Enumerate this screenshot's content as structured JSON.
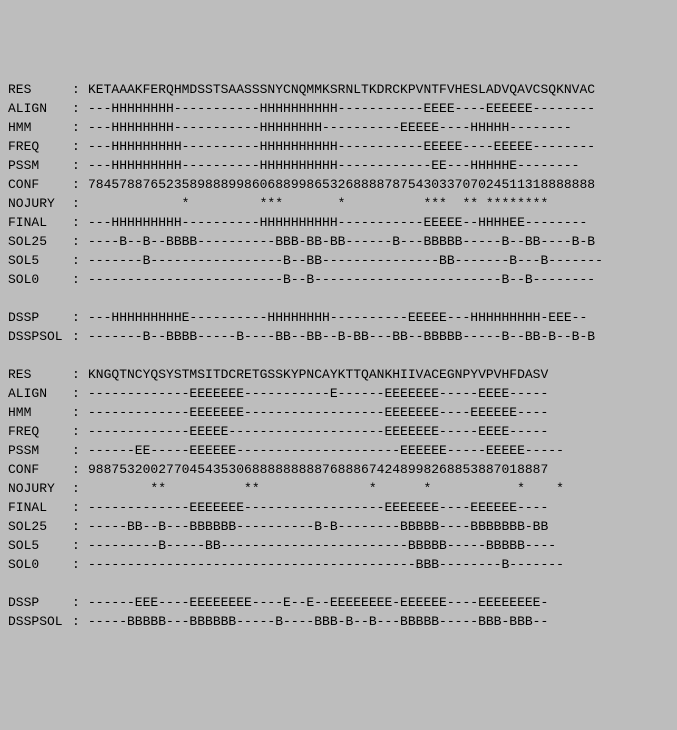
{
  "blocks": [
    {
      "rows": [
        {
          "label": "RES",
          "seq": "KETAAAKFERQHMDSSTSAASSSNYCNQMMKSRNLTKDRCKPVNTFVHESLADVQAVCSQKNVAC"
        },
        {
          "label": "ALIGN",
          "seq": "---HHHHHHHH-----------HHHHHHHHHH-----------EEEE----EEEEEE--------"
        },
        {
          "label": "HMM",
          "seq": "---HHHHHHHH-----------HHHHHHHH----------EEEEE----HHHHH--------"
        },
        {
          "label": "FREQ",
          "seq": "---HHHHHHHHH----------HHHHHHHHHH-----------EEEEE----EEEEE--------"
        },
        {
          "label": "PSSM",
          "seq": "---HHHHHHHHH----------HHHHHHHHHH------------EE---HHHHHE--------"
        },
        {
          "label": "CONF",
          "seq": "78457887652358988899860688998653268888787543033707024511318888888"
        },
        {
          "label": "NOJURY",
          "seq": "            *         ***       *          ***  ** ********"
        },
        {
          "label": "FINAL",
          "seq": "---HHHHHHHHH----------HHHHHHHHHH-----------EEEEE--HHHHEE--------"
        },
        {
          "label": "SOL25",
          "seq": "----B--B--BBBB----------BBB-BB-BB------B---BBBBB-----B--BB----B-B"
        },
        {
          "label": "SOL5",
          "seq": "-------B-----------------B--BB---------------BB-------B---B-------"
        },
        {
          "label": "SOL0",
          "seq": "-------------------------B--B------------------------B--B--------"
        }
      ]
    },
    {
      "rows": [
        {
          "label": "DSSP",
          "seq": "---HHHHHHHHHE----------HHHHHHHH----------EEEEE---HHHHHHHHH-EEE--"
        },
        {
          "label": "DSSPSOL",
          "seq": "-------B--BBBB-----B----BB--BB--B-BB---BB--BBBBB-----B--BB-B--B-B"
        }
      ]
    },
    {
      "rows": [
        {
          "label": "RES",
          "seq": "KNGQTNCYQSYSTMSITDCRETGSSKYPNCAYKTTQANKHIIVACEGNPYVPVHFDASV"
        },
        {
          "label": "ALIGN",
          "seq": "-------------EEEEEEE-----------E------EEEEEEE-----EEEE-----"
        },
        {
          "label": "HMM",
          "seq": "-------------EEEEEEE------------------EEEEEEE----EEEEEE----"
        },
        {
          "label": "FREQ",
          "seq": "-------------EEEEE--------------------EEEEEEE-----EEEE-----"
        },
        {
          "label": "PSSM",
          "seq": "------EE-----EEEEEE---------------------EEEEEE-----EEEEE-----"
        },
        {
          "label": "CONF",
          "seq": "98875320027704543530688888888876888674248998268853887018887"
        },
        {
          "label": "NOJURY",
          "seq": "        **          **              *      *           *    *"
        },
        {
          "label": "FINAL",
          "seq": "-------------EEEEEEE------------------EEEEEEE----EEEEEE----"
        },
        {
          "label": "SOL25",
          "seq": "-----BB--B---BBBBBB----------B-B--------BBBBB----BBBBBBB-BB"
        },
        {
          "label": "SOL5",
          "seq": "---------B-----BB------------------------BBBBB-----BBBBB----"
        },
        {
          "label": "SOL0",
          "seq": "------------------------------------------BBB--------B-------"
        }
      ]
    },
    {
      "rows": [
        {
          "label": "DSSP",
          "seq": "------EEE----EEEEEEEE----E--E--EEEEEEEE-EEEEEE----EEEEEEEE-"
        },
        {
          "label": "DSSPSOL",
          "seq": "-----BBBBB---BBBBBB-----B----BBB-B--B---BBBBB-----BBB-BBB--"
        }
      ]
    }
  ],
  "colon": ":"
}
